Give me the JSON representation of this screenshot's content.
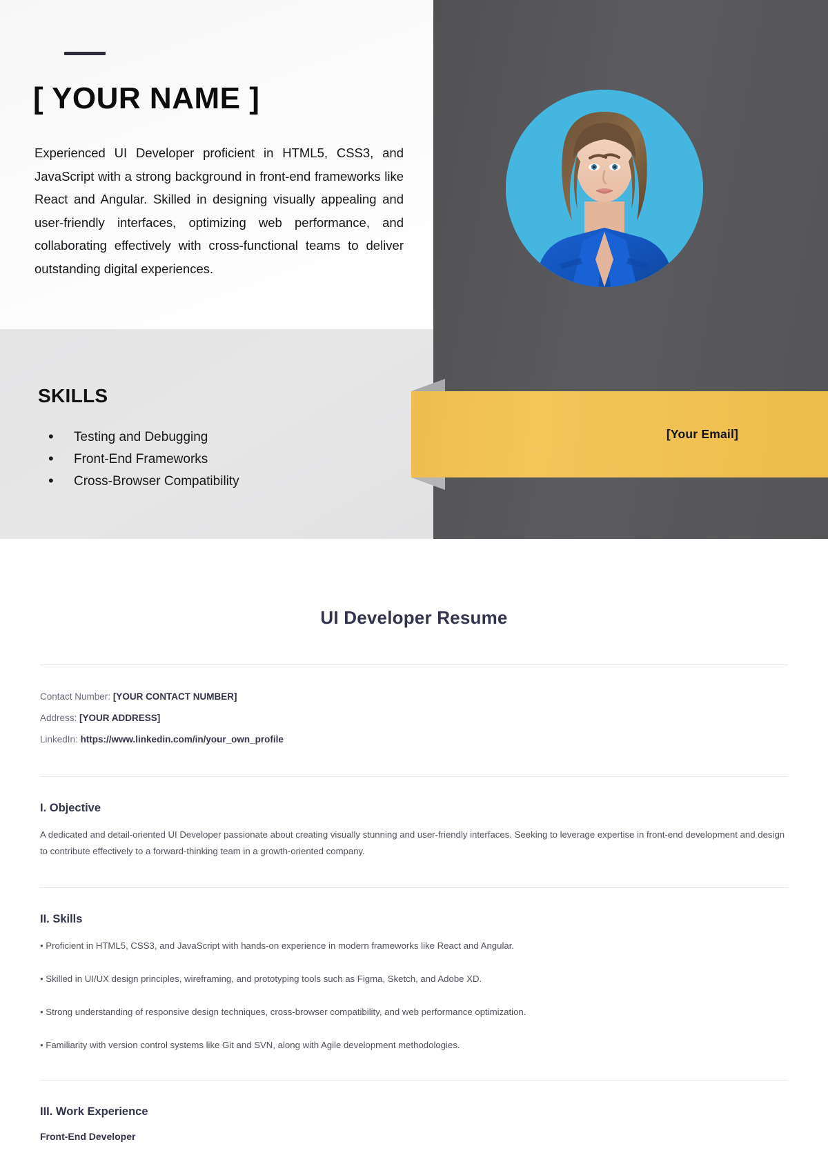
{
  "header": {
    "name": "[ YOUR NAME ]",
    "summary": "Experienced UI Developer proficient in HTML5, CSS3, and JavaScript with a strong background in front-end frameworks like React and Angular. Skilled in designing visually appealing and user-friendly interfaces, optimizing web performance, and collaborating effectively with cross-functional teams to deliver outstanding digital experiences.",
    "email_label": "[Your Email]"
  },
  "skills_panel": {
    "heading": "SKILLS",
    "items": [
      "Testing and Debugging",
      "Front-End Frameworks",
      "Cross-Browser Compatibility"
    ]
  },
  "document": {
    "title": "UI Developer Resume",
    "contact": [
      {
        "label": "Contact Number:",
        "value": "[YOUR CONTACT NUMBER]"
      },
      {
        "label": "Address:",
        "value": "[YOUR ADDRESS]"
      },
      {
        "label": "LinkedIn:",
        "value": "https://www.linkedin.com/in/your_own_profile"
      }
    ],
    "objective": {
      "heading": "I. Objective",
      "body": "A dedicated and detail-oriented UI Developer passionate about creating visually stunning and user-friendly interfaces. Seeking to leverage expertise in front-end development and design to contribute effectively to a forward-thinking team in a growth-oriented company."
    },
    "skills": {
      "heading": "II. Skills",
      "items": [
        "Proficient in HTML5, CSS3, and JavaScript with hands-on experience in modern frameworks like React and Angular.",
        "Skilled in UI/UX design principles, wireframing, and prototyping tools such as Figma, Sketch, and Adobe XD.",
        "Strong understanding of responsive design techniques, cross-browser compatibility, and web performance optimization.",
        "Familiarity with version control systems like Git and SVN, along with Agile development methodologies."
      ]
    },
    "work_experience": {
      "heading": "III. Work Experience",
      "first_entry": "Front-End Developer"
    }
  },
  "colors": {
    "dark_panel": "#55555a",
    "ribbon_yellow": "#f1c153",
    "photo_background": "#45b6e0",
    "blazer_blue": "#1559c4",
    "heading_navy": "#33334d"
  }
}
